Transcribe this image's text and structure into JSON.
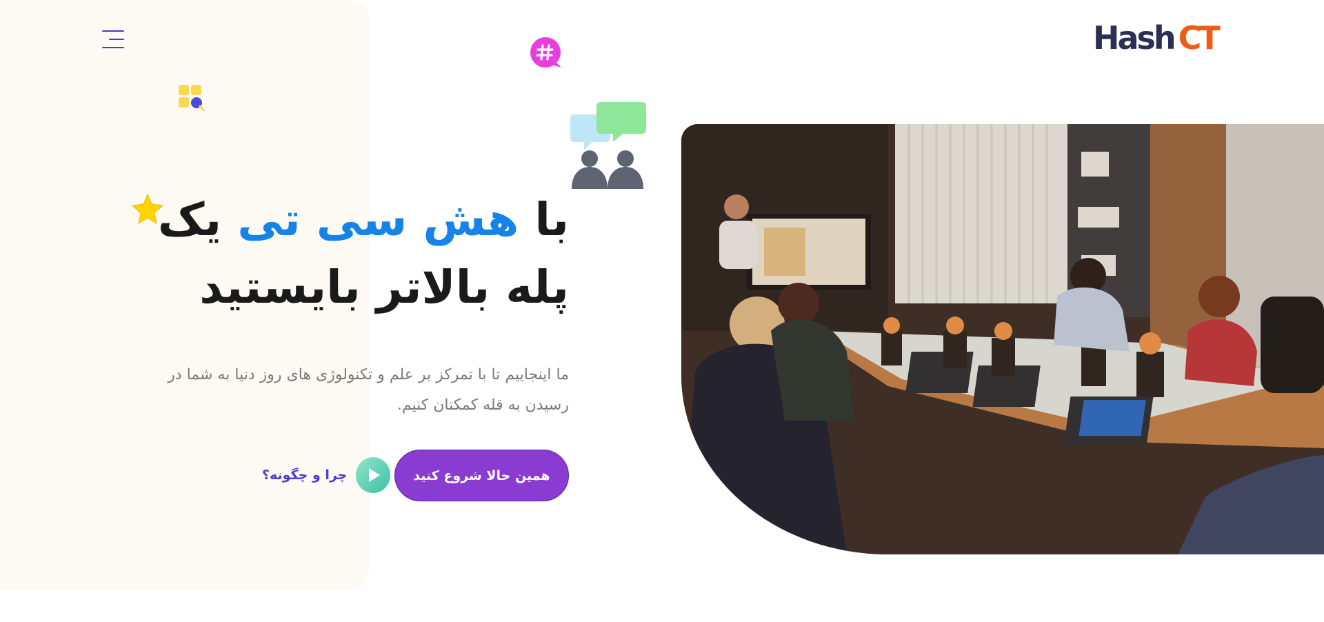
{
  "header": {
    "logo_text": "Hash",
    "logo_mark": "CT",
    "menu_icon": "hamburger-menu-icon"
  },
  "hero": {
    "title_line1_prefix": "با",
    "title_brand": "هش سی تی",
    "title_line1_suffix": "یک",
    "title_line2": "پله بالاتر بایستید",
    "description_line1": "ما اینجاییم تا با تمرکز بر علم و تکنولوژی های روز دنیا به شما در",
    "description_line2": "رسیدن به قله کمکتان کنیم.",
    "cta_label": "همین حالا شروع کنید",
    "secondary_label": "چرا و چگونه؟"
  },
  "decorations": {
    "hash_bubble_icon": "hashtag-bubble-icon",
    "grid_search_icon": "grid-search-icon",
    "chat_people_icon": "chat-people-icon",
    "star_icon": "star-icon",
    "play_icon": "play-icon"
  },
  "colors": {
    "brand_blue": "#1683e8",
    "cta_purple": "#8a3bd1",
    "link_indigo": "#4a3dd6",
    "logo_navy": "#2a2f55",
    "logo_orange": "#ee5c16",
    "panel_cream": "#fdfaf3",
    "play_teal": "#5fd1b8",
    "hash_pink": "#e83ee0"
  }
}
